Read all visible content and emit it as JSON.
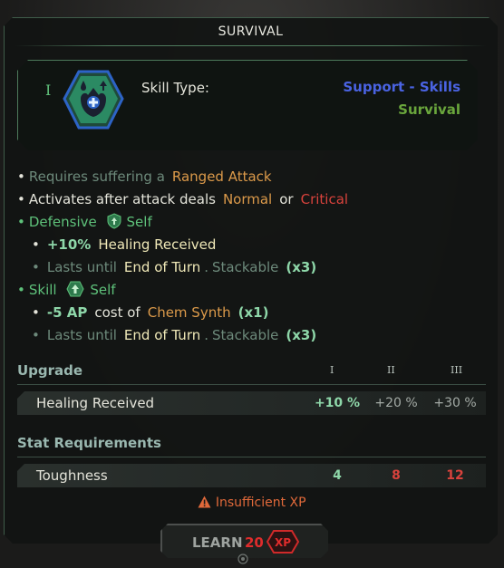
{
  "window": {
    "title": "SURVIVAL"
  },
  "header": {
    "tier_numeral": "I",
    "skill_type_label": "Skill Type:",
    "category": "Support - Skills",
    "tree": "Survival",
    "icon": "survival-skill-icon"
  },
  "lines": {
    "l1": {
      "prefix": "Requires suffering a",
      "value": "Ranged Attack"
    },
    "l2": {
      "prefix": "Activates after attack deals",
      "value1": "Normal",
      "or": "or",
      "value2": "Critical"
    },
    "l3": {
      "label": "Defensive",
      "icon": "shield-up-icon",
      "target": "Self"
    },
    "l4": {
      "amount": "+10%",
      "stat": "Healing Received"
    },
    "l5": {
      "prefix": "Lasts until",
      "value": "End of Turn",
      "sep": ".",
      "stack": "Stackable",
      "count": "(x3)"
    },
    "l6": {
      "label": "Skill",
      "icon": "skill-up-icon",
      "target": "Self"
    },
    "l7": {
      "amount": "-5 AP",
      "mid": "cost of",
      "value": "Chem Synth",
      "count": "(x1)"
    },
    "l8": {
      "prefix": "Lasts until",
      "value": "End of Turn",
      "sep": ".",
      "stack": "Stackable",
      "count": "(x3)"
    }
  },
  "upgrade": {
    "header": "Upgrade",
    "columns": [
      "I",
      "II",
      "III"
    ],
    "rows": [
      {
        "label": "Healing Received",
        "values": [
          "+10 %",
          "+20 %",
          "+30 %"
        ]
      }
    ]
  },
  "requirements": {
    "header": "Stat Requirements",
    "rows": [
      {
        "label": "Toughness",
        "values": [
          "4",
          "8",
          "12"
        ]
      }
    ]
  },
  "warning": {
    "icon": "warning-icon",
    "text": "Insufficient XP"
  },
  "learn": {
    "label": "LEARN",
    "cost": "20",
    "badge": "XP"
  },
  "colors": {
    "accent_green": "#5ec17a",
    "support_blue": "#4a63e2",
    "survival_green": "#6aa63c",
    "orange": "#dc9a4a",
    "red": "#d8423c"
  }
}
